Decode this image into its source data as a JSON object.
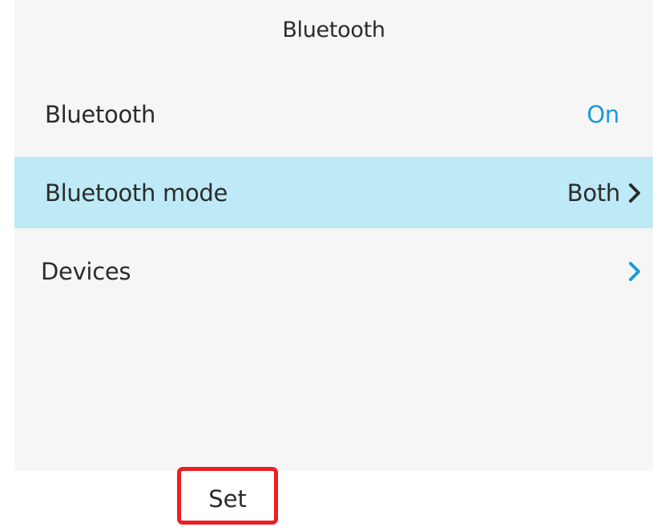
{
  "screen": {
    "title": "Bluetooth",
    "items": [
      {
        "label": "Bluetooth",
        "value": "On",
        "value_color": "#1a9ad6"
      },
      {
        "label": "Bluetooth mode",
        "value": "Both",
        "selected": true,
        "chevron_color": "#2b2b2b"
      },
      {
        "label": "Devices",
        "value": "",
        "chevron_color": "#1a9ad6"
      }
    ]
  },
  "softkeys": {
    "set_label": "Set",
    "highlight_color": "#ee1d23"
  },
  "colors": {
    "accent": "#1a9ad6",
    "selected_row": "#bdeaf6",
    "background": "#f6f6f6"
  }
}
